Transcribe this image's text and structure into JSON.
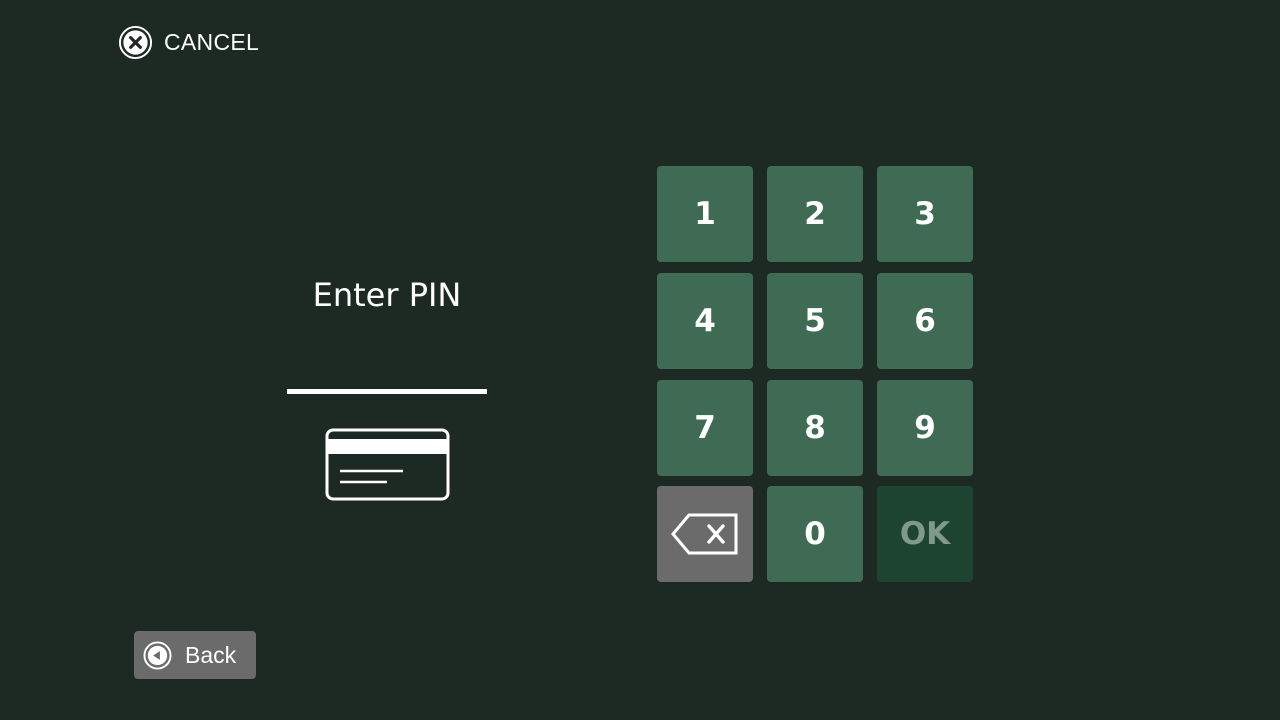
{
  "header": {
    "cancel_label": "CANCEL",
    "cancel_icon": "close-circle-icon"
  },
  "pin": {
    "title": "Enter PIN",
    "card_icon": "credit-card-icon"
  },
  "keypad": {
    "keys": [
      "1",
      "2",
      "3",
      "4",
      "5",
      "6",
      "7",
      "8",
      "9",
      "0"
    ],
    "backspace_icon": "backspace-icon",
    "ok_label": "OK"
  },
  "footer": {
    "back_label": "Back",
    "back_icon": "arrow-left-circle-icon"
  },
  "colors": {
    "background": "#1d2a24",
    "key": "#3f6b55",
    "key_disabled": "#1d4431",
    "key_disabled_text": "#7f9a8c",
    "backspace_key": "#6b6b6b",
    "back_button": "#6b6b6b",
    "text": "#ffffff"
  }
}
